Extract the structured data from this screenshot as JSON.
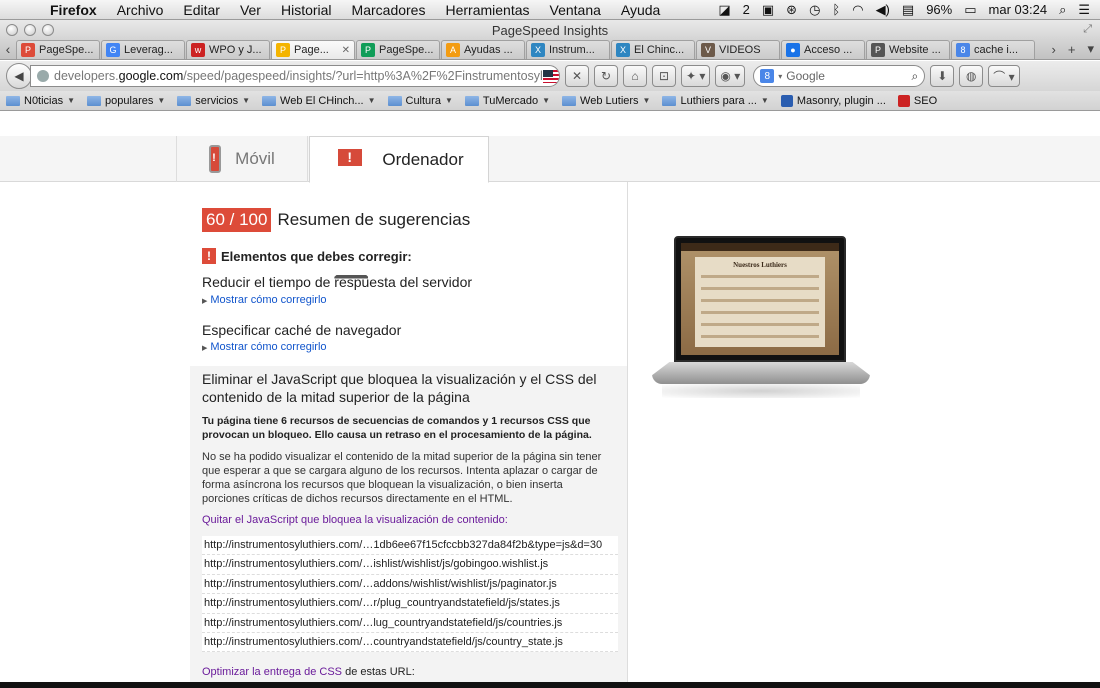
{
  "menubar": {
    "app": "Firefox",
    "items": [
      "Archivo",
      "Editar",
      "Ver",
      "Historial",
      "Marcadores",
      "Herramientas",
      "Ventana",
      "Ayuda"
    ],
    "status": {
      "badge": "2",
      "battery": "96%",
      "clock": "mar 03:24"
    }
  },
  "window": {
    "title": "PageSpeed Insights"
  },
  "tabs": [
    {
      "label": "PageSpe...",
      "color": "#dd4b39",
      "glyph": "P",
      "active": false
    },
    {
      "label": "Leverag...",
      "color": "#4285f4",
      "glyph": "G",
      "active": false
    },
    {
      "label": "WPO y J...",
      "color": "#cc2222",
      "glyph": "w",
      "active": false
    },
    {
      "label": "Page...",
      "color": "#f4b400",
      "glyph": "P",
      "active": true
    },
    {
      "label": "PageSpe...",
      "color": "#0f9d58",
      "glyph": "P",
      "active": false
    },
    {
      "label": "Ayudas ...",
      "color": "#f39c12",
      "glyph": "A",
      "active": false
    },
    {
      "label": "Instrum...",
      "color": "#2e86c1",
      "glyph": "X",
      "active": false
    },
    {
      "label": "El Chinc...",
      "color": "#2e86c1",
      "glyph": "X",
      "active": false
    },
    {
      "label": "VIDEOS",
      "color": "#6d5a4a",
      "glyph": "V",
      "active": false
    },
    {
      "label": "Acceso ...",
      "color": "#1a73e8",
      "glyph": "●",
      "active": false
    },
    {
      "label": "Website ...",
      "color": "#555555",
      "glyph": "P",
      "active": false
    },
    {
      "label": "cache i...",
      "color": "#4a86e8",
      "glyph": "8",
      "active": false
    }
  ],
  "nav": {
    "url_prefix": "developers.",
    "url_host": "google.com",
    "url_rest": "/speed/pagespeed/insights/?url=http%3A%2F%2Finstrumentosyl",
    "search_placeholder": "Google"
  },
  "bookmarks": [
    {
      "label": "N0ticias",
      "type": "folder"
    },
    {
      "label": "populares",
      "type": "folder"
    },
    {
      "label": "servicios",
      "type": "folder"
    },
    {
      "label": "Web El CHinch...",
      "type": "folder"
    },
    {
      "label": "Cultura",
      "type": "folder"
    },
    {
      "label": "TuMercado",
      "type": "folder"
    },
    {
      "label": "Web Lutiers",
      "type": "folder"
    },
    {
      "label": "Luthiers para ...",
      "type": "folder"
    },
    {
      "label": "Masonry, plugin ...",
      "type": "site",
      "color": "#2a5db0"
    },
    {
      "label": "SEO",
      "type": "site",
      "color": "#cc2222"
    }
  ],
  "page": {
    "tab_mobile": "Móvil",
    "tab_desktop": "Ordenador",
    "score": "60 / 100",
    "summary_title": "Resumen de sugerencias",
    "fix_heading": "Elementos que debes corregir:",
    "rule1": "Reducir el tiempo de respuesta del servidor",
    "rule2": "Especificar caché de navegador",
    "show_fix": "Mostrar cómo corregirlo",
    "rule3_title": "Eliminar el JavaScript que bloquea la visualización y el CSS del contenido de la mitad superior de la página",
    "rule3_bold": "Tu página tiene 6 recursos de secuencias de comandos y 1 recursos CSS que provocan un bloqueo. Ello causa un retraso en el procesamiento de la página.",
    "rule3_text": "No se ha podido visualizar el contenido de la mitad superior de la página sin tener que esperar a que se cargara alguno de los recursos. Intenta aplazar o cargar de forma asíncrona los recursos que bloquean la visualización, o bien inserta porciones críticas de dichos recursos directamente en el HTML.",
    "js_link": "Quitar el JavaScript que bloquea la visualización de contenido:",
    "urls": [
      "http://instrumentosyluthiers.com/…1db6ee67f15cfccbb327da84f2b&type=js&d=30",
      "http://instrumentosyluthiers.com/…ishlist/wishlist/js/gobingoo.wishlist.js",
      "http://instrumentosyluthiers.com/…addons/wishlist/wishlist/js/paginator.js",
      "http://instrumentosyluthiers.com/…r/plug_countryandstatefield/js/states.js",
      "http://instrumentosyluthiers.com/…lug_countryandstatefield/js/countries.js",
      "http://instrumentosyluthiers.com/…countryandstatefield/js/country_state.js"
    ],
    "css_link": "Optimizar la entrega de CSS",
    "css_rest": " de estas URL:",
    "laptop_screen_title": "Nuestros Luthiers"
  }
}
